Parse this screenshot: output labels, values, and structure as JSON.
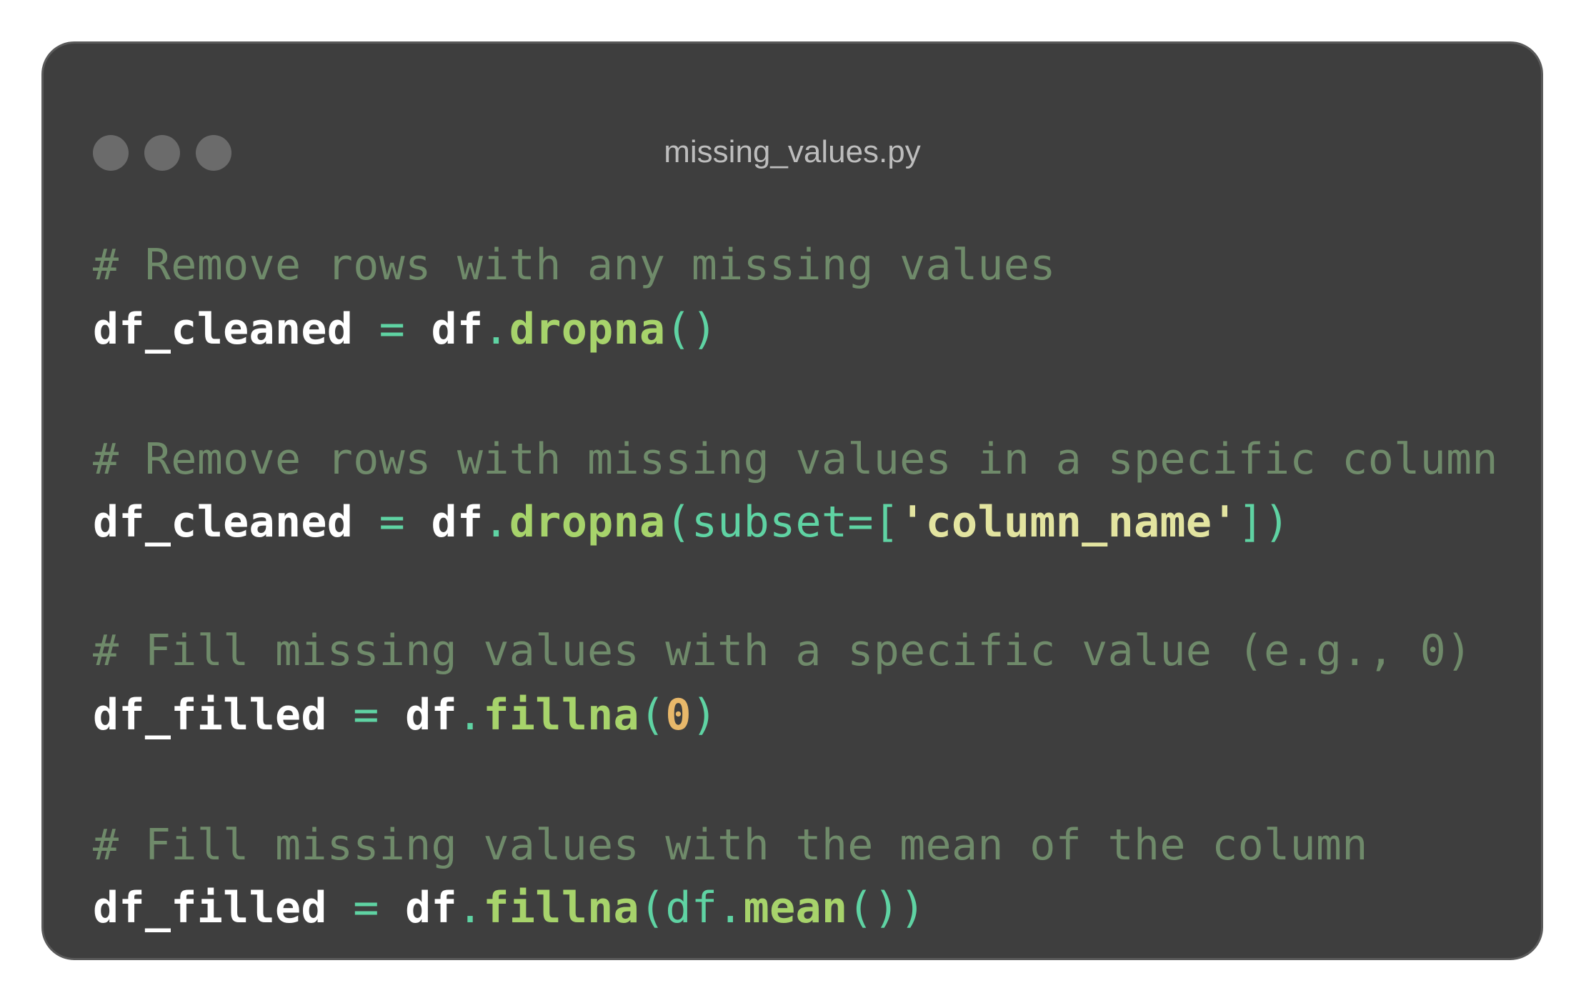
{
  "window": {
    "title": "missing_values.py",
    "dots": [
      "window-dot",
      "window-dot",
      "window-dot"
    ]
  },
  "colors": {
    "background": "#3e3e3e",
    "border": "#5a5a5a",
    "dot": "#6b6b6b",
    "title": "#bdbdbd",
    "comment": "#6f8a6a",
    "identifier": "#ffffff",
    "operator": "#5fd3a3",
    "method": "#a7d36b",
    "punct": "#5fd3a3",
    "string": "#e3e4a0",
    "number": "#e8b86a"
  },
  "code": {
    "lines": [
      [
        {
          "t": "# Remove rows with any missing values",
          "k": "comment"
        }
      ],
      [
        {
          "t": "df_cleaned",
          "k": "identifier"
        },
        {
          "t": " ",
          "k": "identifier"
        },
        {
          "t": "=",
          "k": "operator"
        },
        {
          "t": " ",
          "k": "identifier"
        },
        {
          "t": "df",
          "k": "identifier"
        },
        {
          "t": ".",
          "k": "punct"
        },
        {
          "t": "dropna",
          "k": "method"
        },
        {
          "t": "()",
          "k": "punct"
        }
      ],
      [
        {
          "t": "# Remove rows with missing values in a specific column",
          "k": "comment"
        }
      ],
      [
        {
          "t": "df_cleaned",
          "k": "identifier"
        },
        {
          "t": " ",
          "k": "identifier"
        },
        {
          "t": "=",
          "k": "operator"
        },
        {
          "t": " ",
          "k": "identifier"
        },
        {
          "t": "df",
          "k": "identifier"
        },
        {
          "t": ".",
          "k": "punct"
        },
        {
          "t": "dropna",
          "k": "method"
        },
        {
          "t": "(subset=[",
          "k": "punct"
        },
        {
          "t": "'column_name'",
          "k": "string"
        },
        {
          "t": "])",
          "k": "punct"
        }
      ],
      [
        {
          "t": "# Fill missing values with a specific value (e.g., 0)",
          "k": "comment"
        }
      ],
      [
        {
          "t": "df_filled",
          "k": "identifier"
        },
        {
          "t": " ",
          "k": "identifier"
        },
        {
          "t": "=",
          "k": "operator"
        },
        {
          "t": " ",
          "k": "identifier"
        },
        {
          "t": "df",
          "k": "identifier"
        },
        {
          "t": ".",
          "k": "punct"
        },
        {
          "t": "fillna",
          "k": "method"
        },
        {
          "t": "(",
          "k": "punct"
        },
        {
          "t": "0",
          "k": "number"
        },
        {
          "t": ")",
          "k": "punct"
        }
      ],
      [
        {
          "t": "# Fill missing values with the mean of the column",
          "k": "comment"
        }
      ],
      [
        {
          "t": "df_filled",
          "k": "identifier"
        },
        {
          "t": " ",
          "k": "identifier"
        },
        {
          "t": "=",
          "k": "operator"
        },
        {
          "t": " ",
          "k": "identifier"
        },
        {
          "t": "df",
          "k": "identifier"
        },
        {
          "t": ".",
          "k": "punct"
        },
        {
          "t": "fillna",
          "k": "method"
        },
        {
          "t": "(df.",
          "k": "punct"
        },
        {
          "t": "mean",
          "k": "method"
        },
        {
          "t": "())",
          "k": "punct"
        }
      ]
    ]
  }
}
